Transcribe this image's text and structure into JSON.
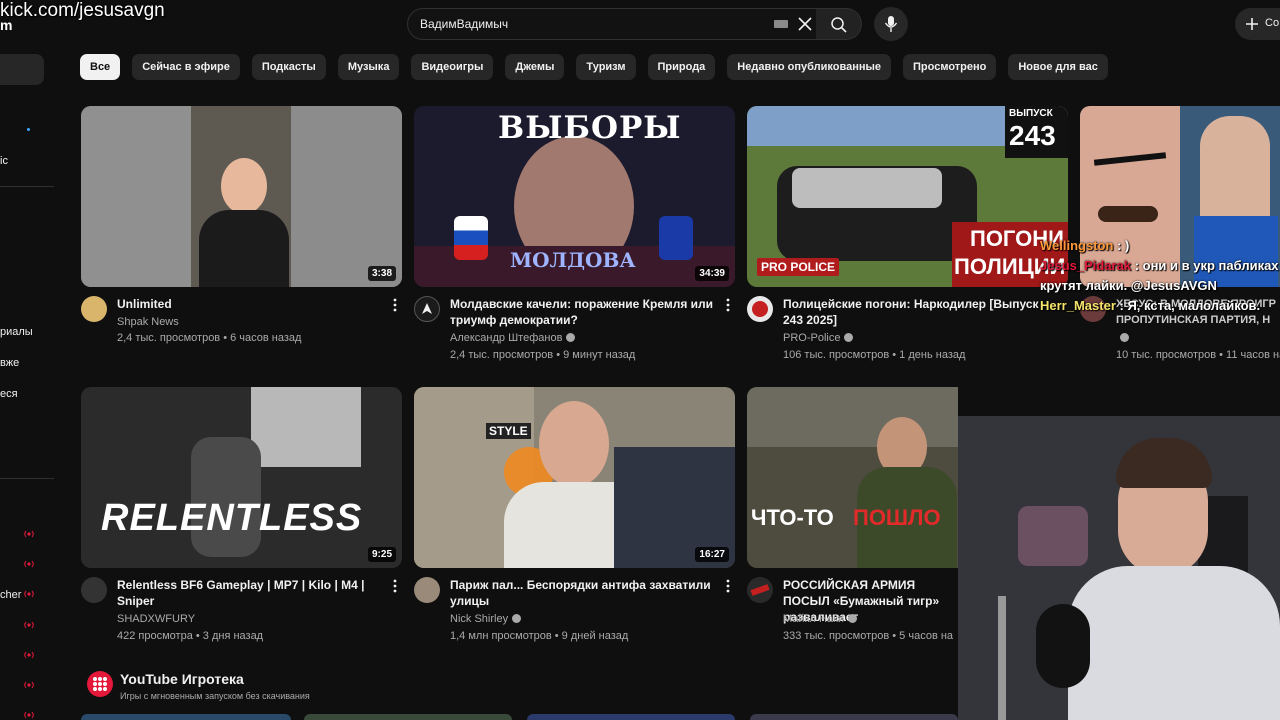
{
  "overlay": {
    "stream_url": "kick.com/jesusavgn",
    "corner_glyph": "m"
  },
  "header": {
    "search_value": "ВадимВадимыч",
    "create_label": "Со",
    "icons": [
      "keyboard-icon",
      "clear-icon",
      "search-icon",
      "mic-icon",
      "plus-icon"
    ]
  },
  "sidebar": {
    "fragments": [
      "ic",
      "риалы",
      "вже",
      "еся",
      "cher"
    ]
  },
  "chips": [
    "Все",
    "Сейчас в эфире",
    "Подкасты",
    "Музыка",
    "Видеоигры",
    "Джемы",
    "Туризм",
    "Природа",
    "Недавно опубликованные",
    "Просмотрено",
    "Новое для вас"
  ],
  "videos": [
    {
      "title": "Unlimited",
      "channel": "Shpak News",
      "verified": false,
      "meta": "2,4 тыс. просмотров • 6 часов назад",
      "duration": "3:38"
    },
    {
      "title": "Молдавские качели: поражение Кремля или триумф демократии?",
      "channel": "Александр Штефанов",
      "verified": true,
      "meta": "2,4 тыс. просмотров • 9 минут назад",
      "duration": "34:39",
      "thumb_text_top": "ВЫБОРЫ",
      "thumb_text_bottom": "МОЛДОВА"
    },
    {
      "title": "Полицейские погони: Наркодилер [Выпуск 243 2025]",
      "channel": "PRO-Police",
      "verified": true,
      "meta": "106 тыс. просмотров • 1 день назад",
      "duration": "",
      "thumb_badge_top": "ВЫПУСК",
      "thumb_badge_num": "243",
      "thumb_text_1": "ПОГОНИ",
      "thumb_text_2": "ПОЛИЦИИ",
      "thumb_logo": "PRO POLICE"
    },
    {
      "title": "ХЕСУС: В МОЛДОВЕ ПРОИГР ПРОПУТИНСКАЯ ПАРТИЯ, Н",
      "channel": "",
      "verified": true,
      "meta": "10 тыс. просмотров • 11 часов на",
      "duration": ""
    },
    {
      "title": "Relentless BF6 Gameplay | MP7 | Kilo | M4 | Sniper",
      "channel": "SHADXWFURY",
      "verified": false,
      "meta": "422 просмотра • 3 дня назад",
      "duration": "9:25",
      "thumb_text": "RELENTLESS"
    },
    {
      "title": "Париж пал... Беспорядки антифа захватили улицы",
      "channel": "Nick Shirley",
      "verified": true,
      "meta": "1,4 млн просмотров • 9 дней назад",
      "duration": "16:27",
      "thumb_text": "STYLE"
    },
    {
      "title": "РОССИЙСКАЯ АРМИЯ ПОСЫЛ «Бумажный тигр» разваливает",
      "channel": "Майкл Наки",
      "verified": true,
      "meta": "333 тыс. просмотров • 5 часов на",
      "duration": "",
      "thumb_text_a": "ЧТО-ТО",
      "thumb_text_b": "ПОШЛО"
    }
  ],
  "playables": {
    "title": "YouTube Игротека",
    "subtitle": "Игры с мгновенным запуском без скачивания"
  },
  "chat": [
    {
      "user": "Wellingston",
      "text": ": )"
    },
    {
      "user": "Jesus_Pidarak",
      "text": ": они и в укр пабликах крутят лайки. @JesusAVGN"
    },
    {
      "user": "Herr_Master",
      "text": ": Я, кста, малолайков."
    }
  ],
  "colors": {
    "background": "#0f0f0f",
    "chip": "#272727",
    "chip_active": "#f1f1f1",
    "secondary_text": "#aaaaaa",
    "live_red": "#e2193a"
  }
}
